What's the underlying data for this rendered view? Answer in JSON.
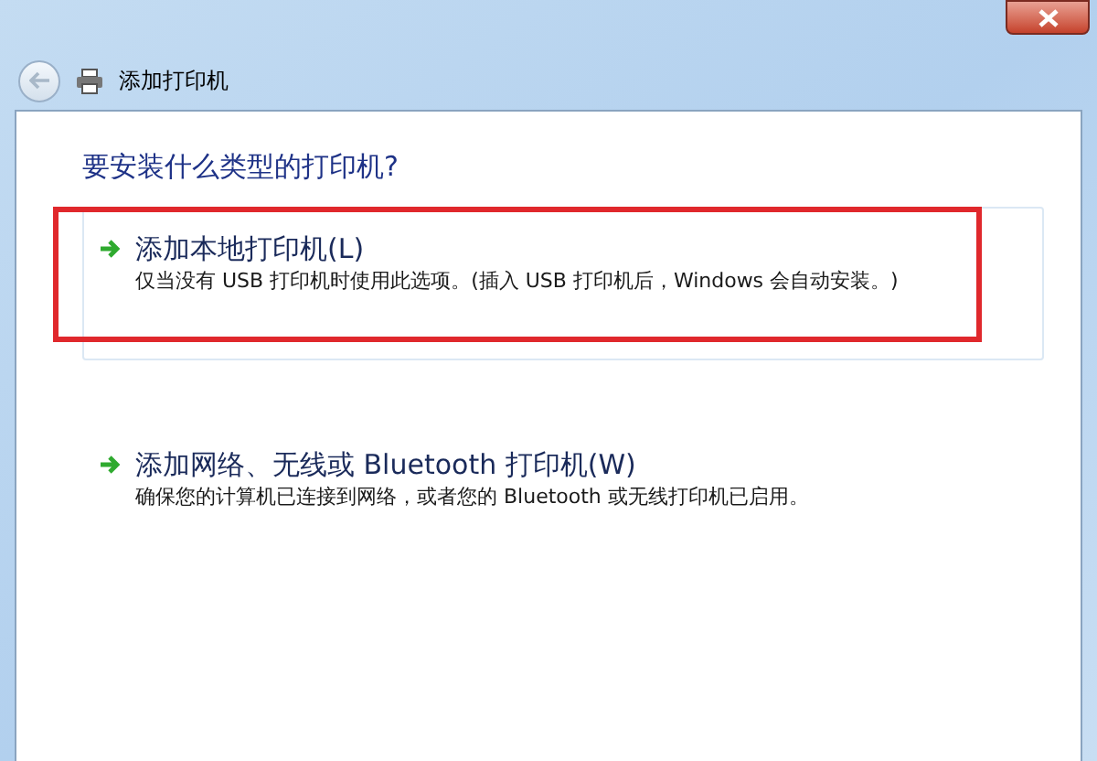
{
  "window": {
    "title": "添加打印机"
  },
  "heading": "要安装什么类型的打印机?",
  "options": [
    {
      "title": "添加本地打印机(L)",
      "description": "仅当没有 USB 打印机时使用此选项。(插入 USB 打印机后，Windows 会自动安装。)",
      "selected": true,
      "highlighted": true
    },
    {
      "title": "添加网络、无线或 Bluetooth 打印机(W)",
      "description": "确保您的计算机已连接到网络，或者您的 Bluetooth 或无线打印机已启用。",
      "selected": false,
      "highlighted": false
    }
  ]
}
